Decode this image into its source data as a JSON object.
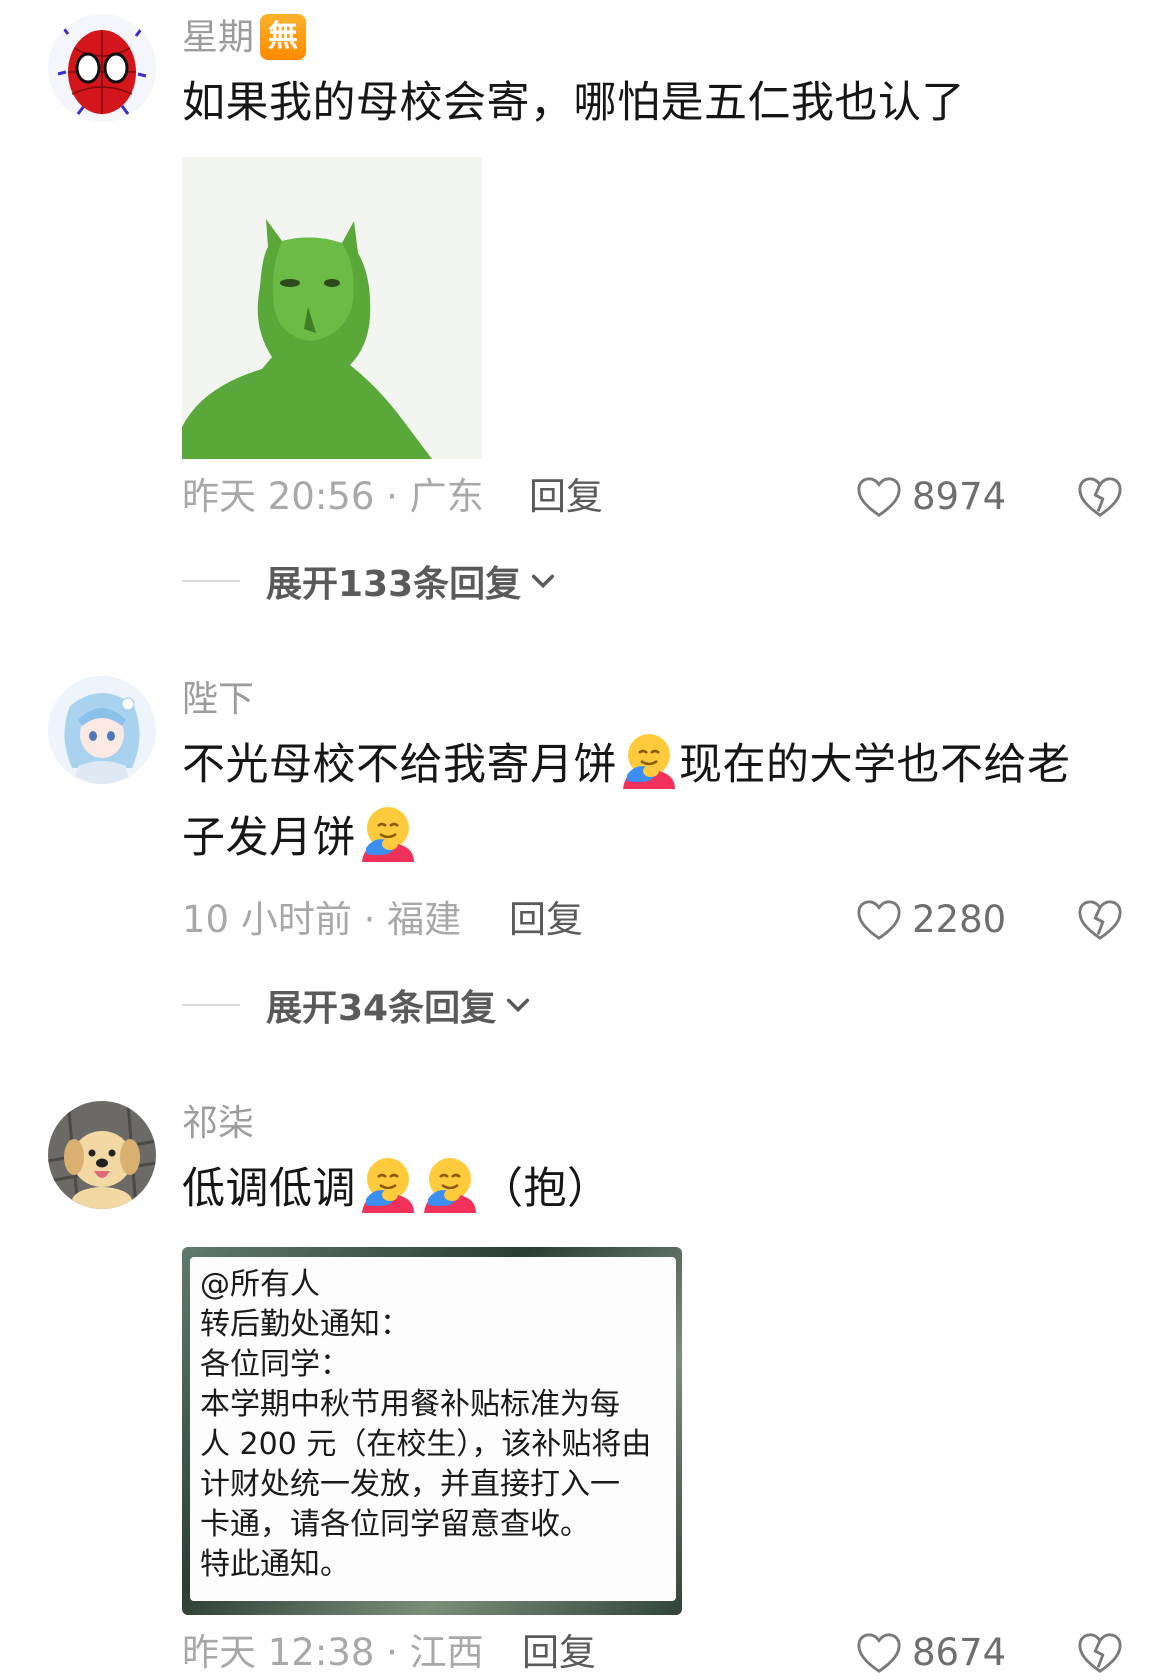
{
  "comments": [
    {
      "username": "星期",
      "badge": "無",
      "text": "如果我的母校会寄，哪怕是五仁我也认了",
      "time_location": "昨天 20:56 · 广东",
      "reply_label": "回复",
      "likes": "8974",
      "expand_label": "展开133条回复"
    },
    {
      "username": "陛下",
      "text_part1": "不光母校不给我寄月饼",
      "text_part2": "现在的大学也不给老子发月饼",
      "time_location": "10 小时前 · 福建",
      "reply_label": "回复",
      "likes": "2280",
      "expand_label": "展开34条回复"
    },
    {
      "username": "祁柒",
      "text_part1": "低调低调",
      "text_part2": "（抱）",
      "notice_lines": [
        "@所有人",
        "转后勤处通知：",
        "各位同学：",
        "本学期中秋节用餐补贴标准为每",
        "人 200 元（在校生），该补贴将由",
        "计财处统一发放，并直接打入一",
        "卡通，请各位同学留意查收。",
        "特此通知。"
      ],
      "time_location": "昨天 12:38 · 江西",
      "reply_label": "回复",
      "likes": "8674"
    }
  ],
  "icons": {
    "like": "heart-outline-icon",
    "dislike": "broken-heart-icon",
    "expand": "chevron-down-icon",
    "emoji": "hugging-face-emoji"
  },
  "colors": {
    "text": "#161616",
    "meta": "#a8a8a8",
    "username": "#9c9c9c",
    "badge": "#ff9a16"
  }
}
